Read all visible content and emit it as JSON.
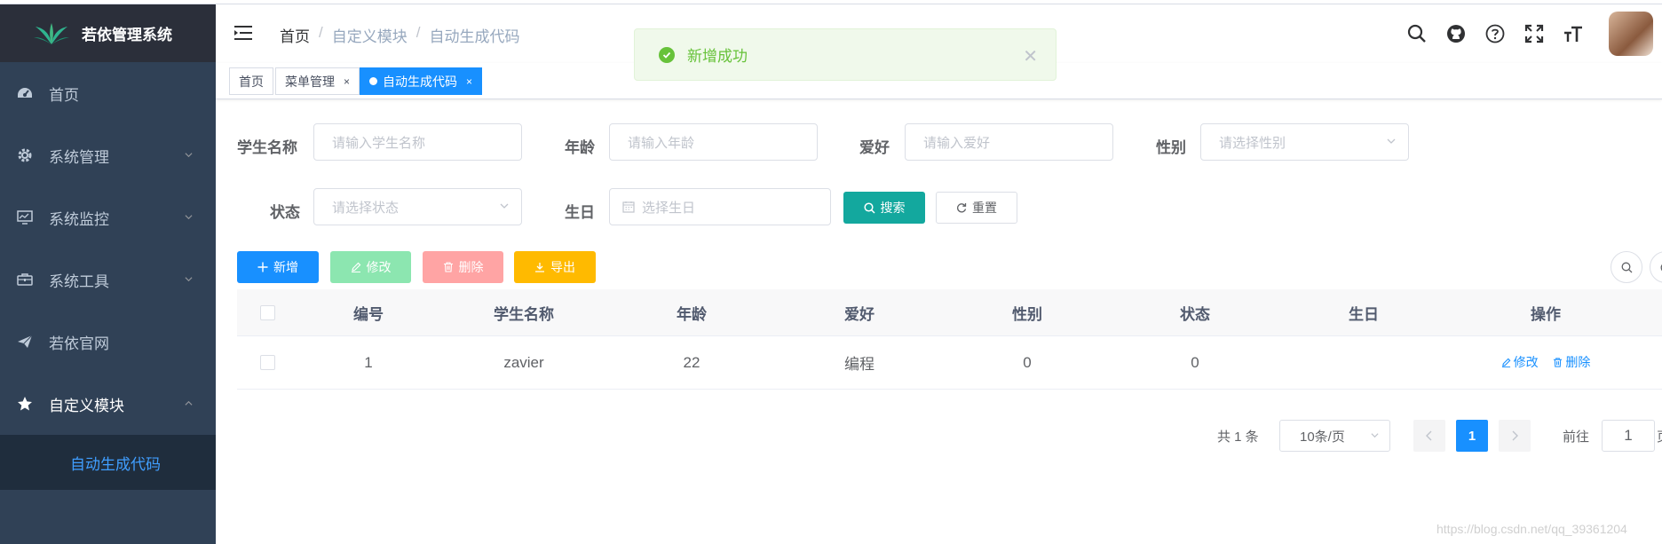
{
  "app": {
    "title": "若依管理系统"
  },
  "sidebar": {
    "items": [
      {
        "label": "首页",
        "icon": "dashboard-icon"
      },
      {
        "label": "系统管理",
        "icon": "gear-icon"
      },
      {
        "label": "系统监控",
        "icon": "monitor-icon"
      },
      {
        "label": "系统工具",
        "icon": "toolbox-icon"
      },
      {
        "label": "若依官网",
        "icon": "paper-plane-icon"
      },
      {
        "label": "自定义模块",
        "icon": "star-icon"
      }
    ],
    "sub_item": "自动生成代码"
  },
  "breadcrumb": {
    "home": "首页",
    "sep": "/",
    "module": "自定义模块",
    "page": "自动生成代码"
  },
  "tags": [
    {
      "label": "首页"
    },
    {
      "label": "菜单管理",
      "close": "×"
    },
    {
      "label": "自动生成代码",
      "close": "×"
    }
  ],
  "toast": {
    "text": "新增成功",
    "close": "✕"
  },
  "form": {
    "name_label": "学生名称",
    "name_placeholder": "请输入学生名称",
    "age_label": "年龄",
    "age_placeholder": "请输入年龄",
    "hobby_label": "爱好",
    "hobby_placeholder": "请输入爱好",
    "gender_label": "性别",
    "gender_placeholder": "请选择性别",
    "status_label": "状态",
    "status_placeholder": "请选择状态",
    "birthday_label": "生日",
    "birthday_placeholder": "选择生日",
    "search_button": "搜索",
    "reset_button": "重置"
  },
  "toolbar": {
    "add": "新增",
    "edit": "修改",
    "delete": "删除",
    "export": "导出"
  },
  "table": {
    "columns": [
      "编号",
      "学生名称",
      "年龄",
      "爱好",
      "性别",
      "状态",
      "生日",
      "操作"
    ],
    "rows": [
      {
        "id": "1",
        "name": "zavier",
        "age": "22",
        "hobby": "编程",
        "gender": "0",
        "status": "0",
        "birthday": "",
        "edit": "修改",
        "delete": "删除"
      }
    ]
  },
  "pagination": {
    "total": "共 1 条",
    "page_size": "10条/页",
    "current": "1",
    "goto_label": "前往",
    "goto_value": "1",
    "page_suffix": "页"
  },
  "watermark": "https://blog.csdn.net/qq_39361204",
  "colors": {
    "primary": "#1890ff",
    "sidebar": "#304156",
    "success": "#67c23a",
    "search": "#13a89e"
  }
}
